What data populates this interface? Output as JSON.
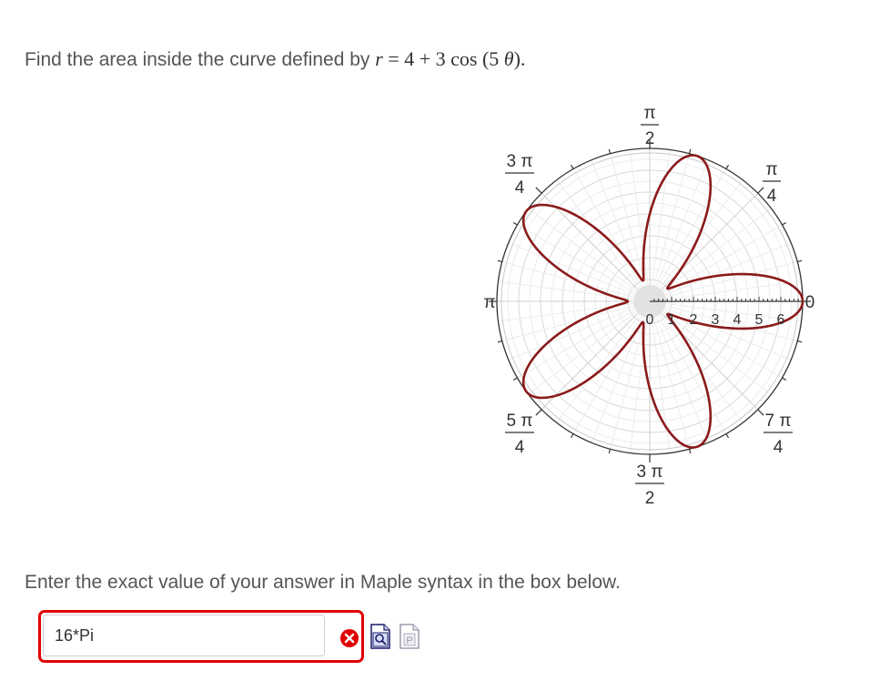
{
  "question": {
    "prefix": "Find the area inside the curve defined by ",
    "var_r": "r",
    "equals": " = 4 + 3 cos (5 ",
    "var_theta": "θ",
    "suffix": ")."
  },
  "plot": {
    "radial_tick_labels": [
      "0",
      "1",
      "2",
      "3",
      "4",
      "5",
      "6"
    ],
    "angle_labels": {
      "pi_over_2": {
        "num": "π",
        "den": "2"
      },
      "pi_over_4": {
        "num": "π",
        "den": "4"
      },
      "three_pi_over_4": {
        "num": "3 π",
        "den": "4"
      },
      "pi": "π",
      "zero": "0",
      "five_pi_over_4": {
        "num": "5 π",
        "den": "4"
      },
      "three_pi_over_2": {
        "num": "3 π",
        "den": "2"
      },
      "seven_pi_over_4": {
        "num": "7 π",
        "den": "4"
      }
    },
    "curve_color": "#8b1a1a"
  },
  "instruction": "Enter the exact value of your answer in Maple syntax in the box below.",
  "answer": {
    "value": "16*Pi",
    "status": "incorrect",
    "status_color": "#e00000"
  },
  "icons": {
    "status": "x-circle-icon",
    "preview": "preview-icon",
    "maple": "maple-syntax-icon"
  }
}
